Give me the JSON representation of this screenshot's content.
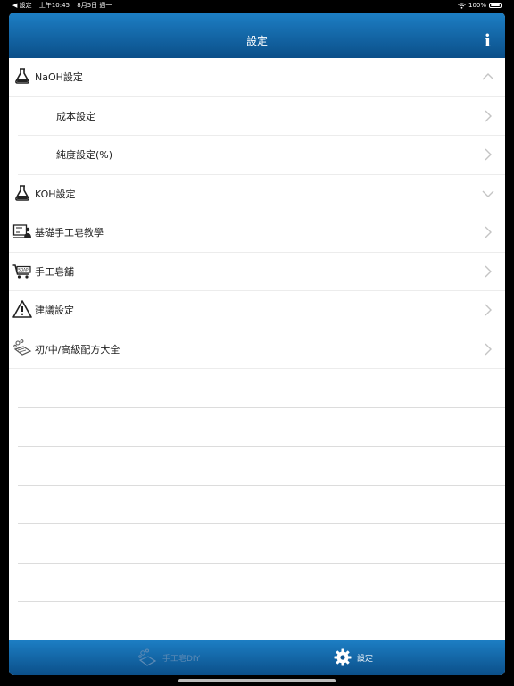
{
  "status_bar": {
    "back_app": "◀ 設定",
    "time": "上午10:45",
    "date": "8月5日 週一",
    "battery": "100%"
  },
  "nav": {
    "title": "設定",
    "info_label": "i"
  },
  "list": {
    "naoh": "NaOH設定",
    "cost": "成本設定",
    "purity": "純度設定(%)",
    "koh": "KOH設定",
    "tutorial": "基礎手工皂教學",
    "shop": "手工皂舖",
    "suggest": "建議設定",
    "recipes": "初/中/高級配方大全"
  },
  "tabs": {
    "diy": "手工皂DIY",
    "settings": "設定"
  }
}
